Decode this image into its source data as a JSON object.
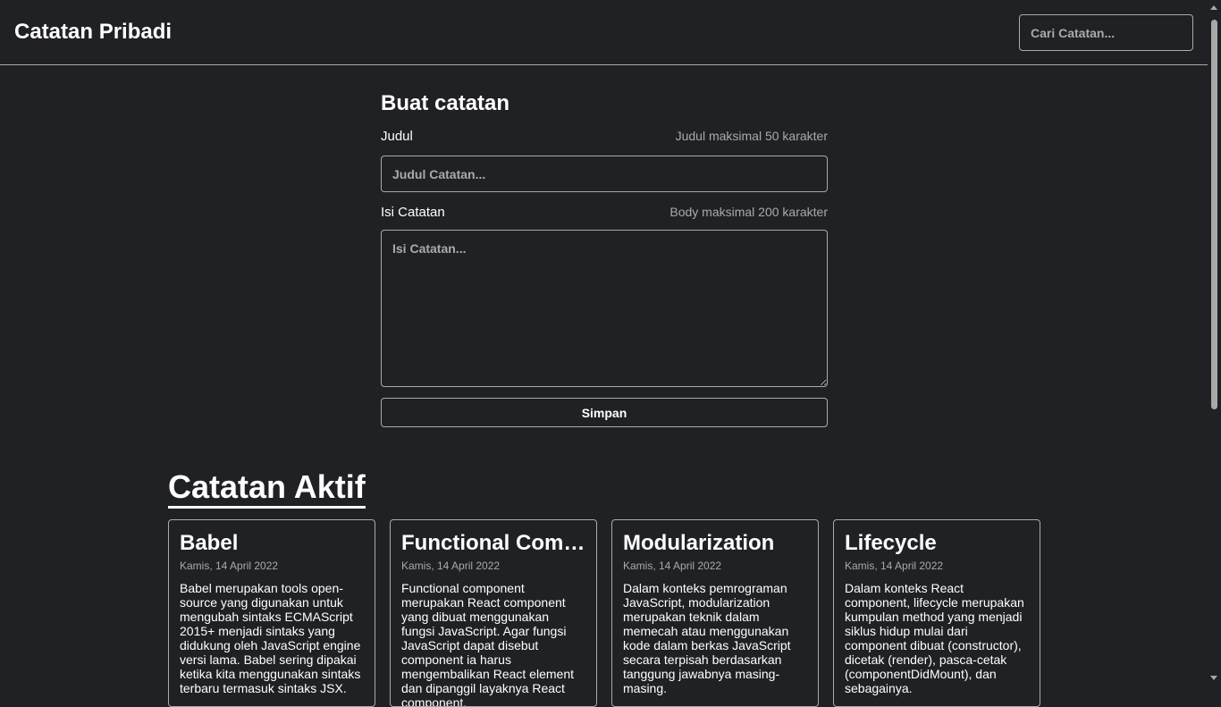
{
  "header": {
    "title": "Catatan Pribadi",
    "search_placeholder": "Cari Catatan..."
  },
  "form": {
    "heading": "Buat catatan",
    "title_label": "Judul",
    "title_hint": "Judul maksimal 50 karakter",
    "title_placeholder": "Judul Catatan...",
    "body_label": "Isi Catatan",
    "body_hint": "Body maksimal 200 karakter",
    "body_placeholder": "Isi Catatan...",
    "save_label": "Simpan"
  },
  "active_section": {
    "heading": "Catatan Aktif",
    "notes": [
      {
        "title": "Babel",
        "date": "Kamis, 14 April 2022",
        "body": "Babel merupakan tools open-source yang digunakan untuk mengubah sintaks ECMAScript 2015+ menjadi sintaks yang didukung oleh JavaScript engine versi lama. Babel sering dipakai ketika kita menggunakan sintaks terbaru termasuk sintaks JSX."
      },
      {
        "title": "Functional Component",
        "date": "Kamis, 14 April 2022",
        "body": "Functional component merupakan React component yang dibuat menggunakan fungsi JavaScript. Agar fungsi JavaScript dapat disebut component ia harus mengembalikan React element dan dipanggil layaknya React component."
      },
      {
        "title": "Modularization",
        "date": "Kamis, 14 April 2022",
        "body": "Dalam konteks pemrograman JavaScript, modularization merupakan teknik dalam memecah atau menggunakan kode dalam berkas JavaScript secara terpisah berdasarkan tanggung jawabnya masing-masing."
      },
      {
        "title": "Lifecycle",
        "date": "Kamis, 14 April 2022",
        "body": "Dalam konteks React component, lifecycle merupakan kumpulan method yang menjadi siklus hidup mulai dari component dibuat (constructor), dicetak (render), pasca-cetak (componentDidMount), dan sebagainya."
      }
    ]
  }
}
